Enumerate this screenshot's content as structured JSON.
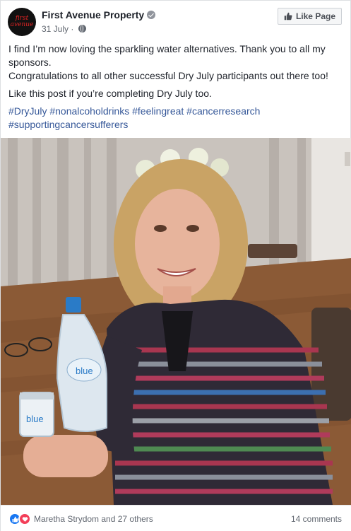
{
  "post": {
    "page_name": "First Avenue Property",
    "avatar_line1": "first",
    "avatar_line2": "avenue",
    "date": "31 July",
    "separator": "·",
    "like_page_label": "Like Page",
    "paragraph1": "I find I’m now loving the sparkling water alternatives. Thank you to all my sponsors.",
    "paragraph2": "Congratulations to all other successful Dry July participants out there too!",
    "paragraph3": "Like this post if you’re completing Dry July too.",
    "hashtags": [
      "#DryJuly",
      "#nonalcoholdrinks",
      "#feelingreat",
      "#cancerresearch",
      "#supportingcancersufferers"
    ]
  },
  "photo": {
    "bottle_label": "blue",
    "can_label": "blue"
  },
  "footer": {
    "reactors": "Maretha Strydom and 27 others",
    "comments": "14 comments"
  },
  "colors": {
    "link": "#365899",
    "like_blue": "#1877f2",
    "love_red": "#f33e58"
  },
  "icons": [
    "verified-icon",
    "globe-icon",
    "thumbs-up-icon",
    "like-reaction-icon",
    "love-reaction-icon"
  ]
}
